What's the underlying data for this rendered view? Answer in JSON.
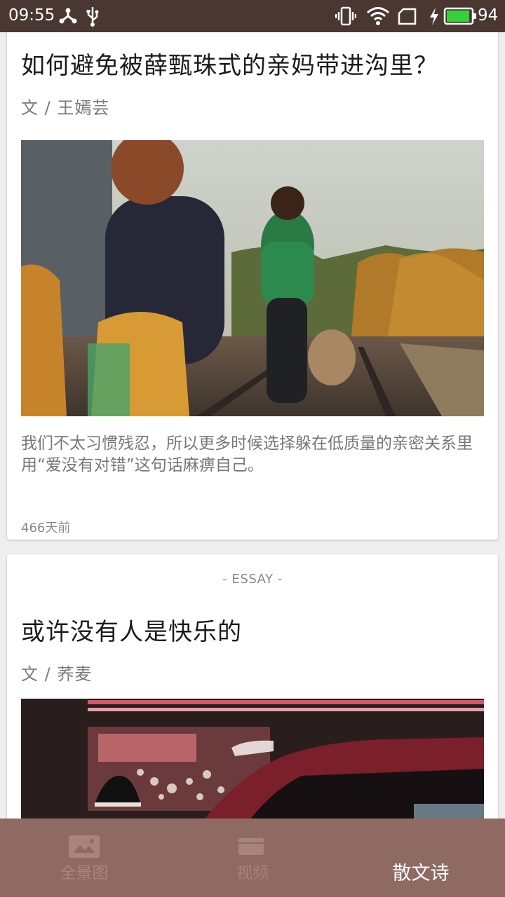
{
  "status_bar": {
    "time": "09:55",
    "battery_level": "94",
    "battery_color": "#35d13a",
    "icons": [
      "usb-debug-icon",
      "usb-icon",
      "vibrate-icon",
      "wifi-icon",
      "sim-icon",
      "charging-icon",
      "battery-icon"
    ]
  },
  "articles": [
    {
      "title": "如何避免被薛甄珠式的亲妈带进沟里？",
      "author": "文 / 王嫣芸",
      "excerpt": "我们不太习惯残忍，所以更多时候选择躲在低质量的亲密关系里用“爱没有对错”这句话麻痹自己。",
      "time_ago": "466天前"
    },
    {
      "tag": "- ESSAY -",
      "title": "或许没有人是快乐的",
      "author": "文 / 荞麦"
    }
  ],
  "bottom_nav": {
    "items": [
      {
        "label": "全景图",
        "icon": "panorama-image-icon",
        "active": false
      },
      {
        "label": "视频",
        "icon": "video-icon",
        "active": false
      },
      {
        "label": "散文诗",
        "active": true
      }
    ]
  },
  "colors": {
    "status_bar": "#4a3732",
    "bottom_nav": "#8f6a62",
    "nav_inactive": "#a8847b",
    "nav_active": "#ffffff"
  }
}
